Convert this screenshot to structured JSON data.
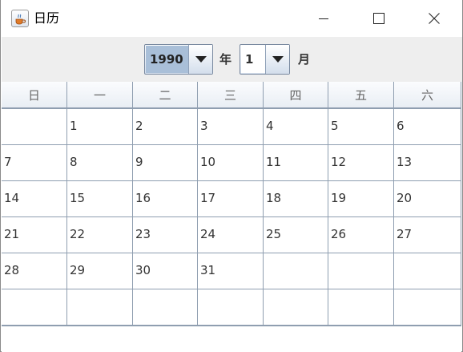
{
  "window": {
    "title": "日历"
  },
  "toolbar": {
    "year_value": "1990",
    "year_unit": "年",
    "month_value": "1",
    "month_unit": "月"
  },
  "weekdays": [
    "日",
    "一",
    "二",
    "三",
    "四",
    "五",
    "六"
  ],
  "weeks": [
    [
      "",
      "1",
      "2",
      "3",
      "4",
      "5",
      "6"
    ],
    [
      "7",
      "8",
      "9",
      "10",
      "11",
      "12",
      "13"
    ],
    [
      "14",
      "15",
      "16",
      "17",
      "18",
      "19",
      "20"
    ],
    [
      "21",
      "22",
      "23",
      "24",
      "25",
      "26",
      "27"
    ],
    [
      "28",
      "29",
      "30",
      "31",
      "",
      "",
      ""
    ],
    [
      "",
      "",
      "",
      "",
      "",
      "",
      ""
    ]
  ],
  "icons": {
    "app": "java-cup-icon",
    "minimize": "minimize-icon",
    "maximize": "maximize-icon",
    "close": "close-icon",
    "dropdown": "chevron-down-icon"
  },
  "colors": {
    "grid_line": "#8f9eb0",
    "selected_year_bg": "#a9bfd8",
    "toolbar_bg": "#eeeeee"
  }
}
